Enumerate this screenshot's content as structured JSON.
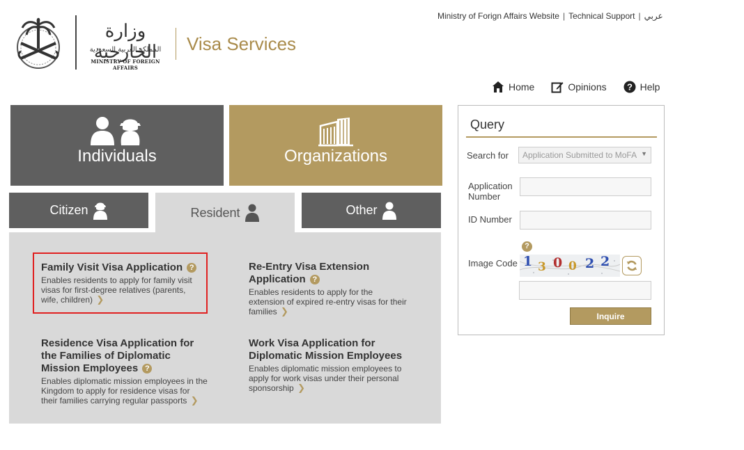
{
  "header": {
    "ministry_ar": "وزارة الخارجية",
    "ministry_ar_sub": "المملكة العربية السعودية",
    "ministry_en": "MINISTRY OF FOREIGN AFFAIRS",
    "service_title": "Visa Services"
  },
  "top_links": {
    "website": "Ministry of Forign Affairs Website",
    "support": "Technical Support",
    "arabic": "عربي",
    "separator": "|"
  },
  "nav": {
    "home": "Home",
    "opinions": "Opinions",
    "help": "Help"
  },
  "tiles": {
    "individuals": "Individuals",
    "organizations": "Organizations"
  },
  "tabs": {
    "citizen": "Citizen",
    "resident": "Resident",
    "other": "Other",
    "active": "Resident"
  },
  "services": [
    {
      "title": "Family Visit Visa Application",
      "desc": "Enables residents to apply for family visit visas for first-degree relatives (parents, wife, children)"
    },
    {
      "title": "Re-Entry Visa Extension Application",
      "desc": "Enables residents to apply for the extension of expired re-entry visas for their families"
    },
    {
      "title": "Residence Visa Application for the Families of Diplomatic Mission Employees",
      "desc": "Enables diplomatic mission employees in the Kingdom to apply for residence visas for their families carrying regular passports"
    },
    {
      "title": "Work Visa Application for Diplomatic Mission Employees",
      "desc": "Enables diplomatic mission employees to apply for work visas under their personal sponsorship"
    }
  ],
  "query": {
    "title": "Query",
    "search_for_label": "Search for",
    "search_for_value": "Application Submitted to MoFA",
    "application_number_label": "Application Number",
    "application_number_value": "",
    "id_number_label": "ID Number",
    "id_number_value": "",
    "image_code_label": "Image Code",
    "captcha_chars": [
      "1",
      "3",
      "0",
      "0",
      "2",
      "2"
    ],
    "captcha_value": "",
    "inquire_label": "Inquire"
  },
  "colors": {
    "gold": "#b39a60",
    "dark_gray": "#5f5f5f",
    "panel_gray": "#d9d9d9",
    "highlight_red": "#e02020"
  },
  "symbols": {
    "question": "?",
    "chevron": "❯",
    "select_arrow": "▼"
  }
}
